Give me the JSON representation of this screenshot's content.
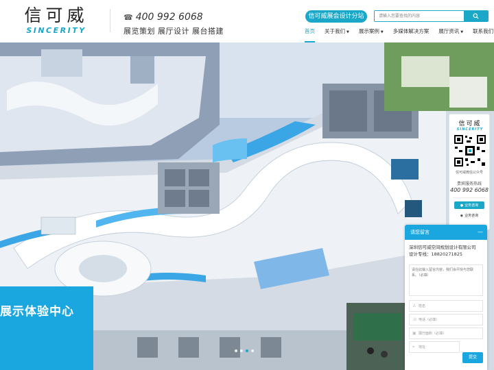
{
  "brand": {
    "logo_cn": "信可威",
    "logo_en": "SINCERITY"
  },
  "header": {
    "hotline": "400 992 6068",
    "slogan": "展览策划 展厅设计 展台搭建",
    "subsite_label": "信可威展会设计分站",
    "search_placeholder": "请输入您要查找的内容"
  },
  "nav": {
    "items": [
      {
        "label": "首页",
        "active": true,
        "dropdown": false
      },
      {
        "label": "关于我们",
        "dropdown": true
      },
      {
        "label": "展示案例",
        "dropdown": true
      },
      {
        "label": "多媒体解决方案",
        "dropdown": false
      },
      {
        "label": "展厅资讯",
        "dropdown": true
      },
      {
        "label": "联系我们",
        "dropdown": false
      }
    ]
  },
  "banner": {
    "caption": "展示体验中心",
    "slides": 4,
    "active_slide": 2
  },
  "qr_panel": {
    "logo_cn": "信可威",
    "logo_en": "SINCERITY",
    "qr_caption": "信可威微信公众号",
    "hotline_label": "贵宾服务热线",
    "hotline": "400 992 6068",
    "service1": "业务咨询",
    "service2": "业务咨询"
  },
  "message": {
    "title": "请您留言",
    "close": "—",
    "company": "深圳信可威空间规划设计有限公司",
    "design_line": "设计专线：18820271825",
    "content_placeholder": "请在此输入留言内容，我们会尽快与您联系。（必填）",
    "name_placeholder": "姓名",
    "phone_placeholder": "电话（必填）",
    "area_placeholder": "展厅面积（必填）",
    "address_placeholder": "地址",
    "submit": "提交"
  },
  "colors": {
    "accent": "#1aa7c8",
    "caption_bg": "#1aa7e0"
  }
}
